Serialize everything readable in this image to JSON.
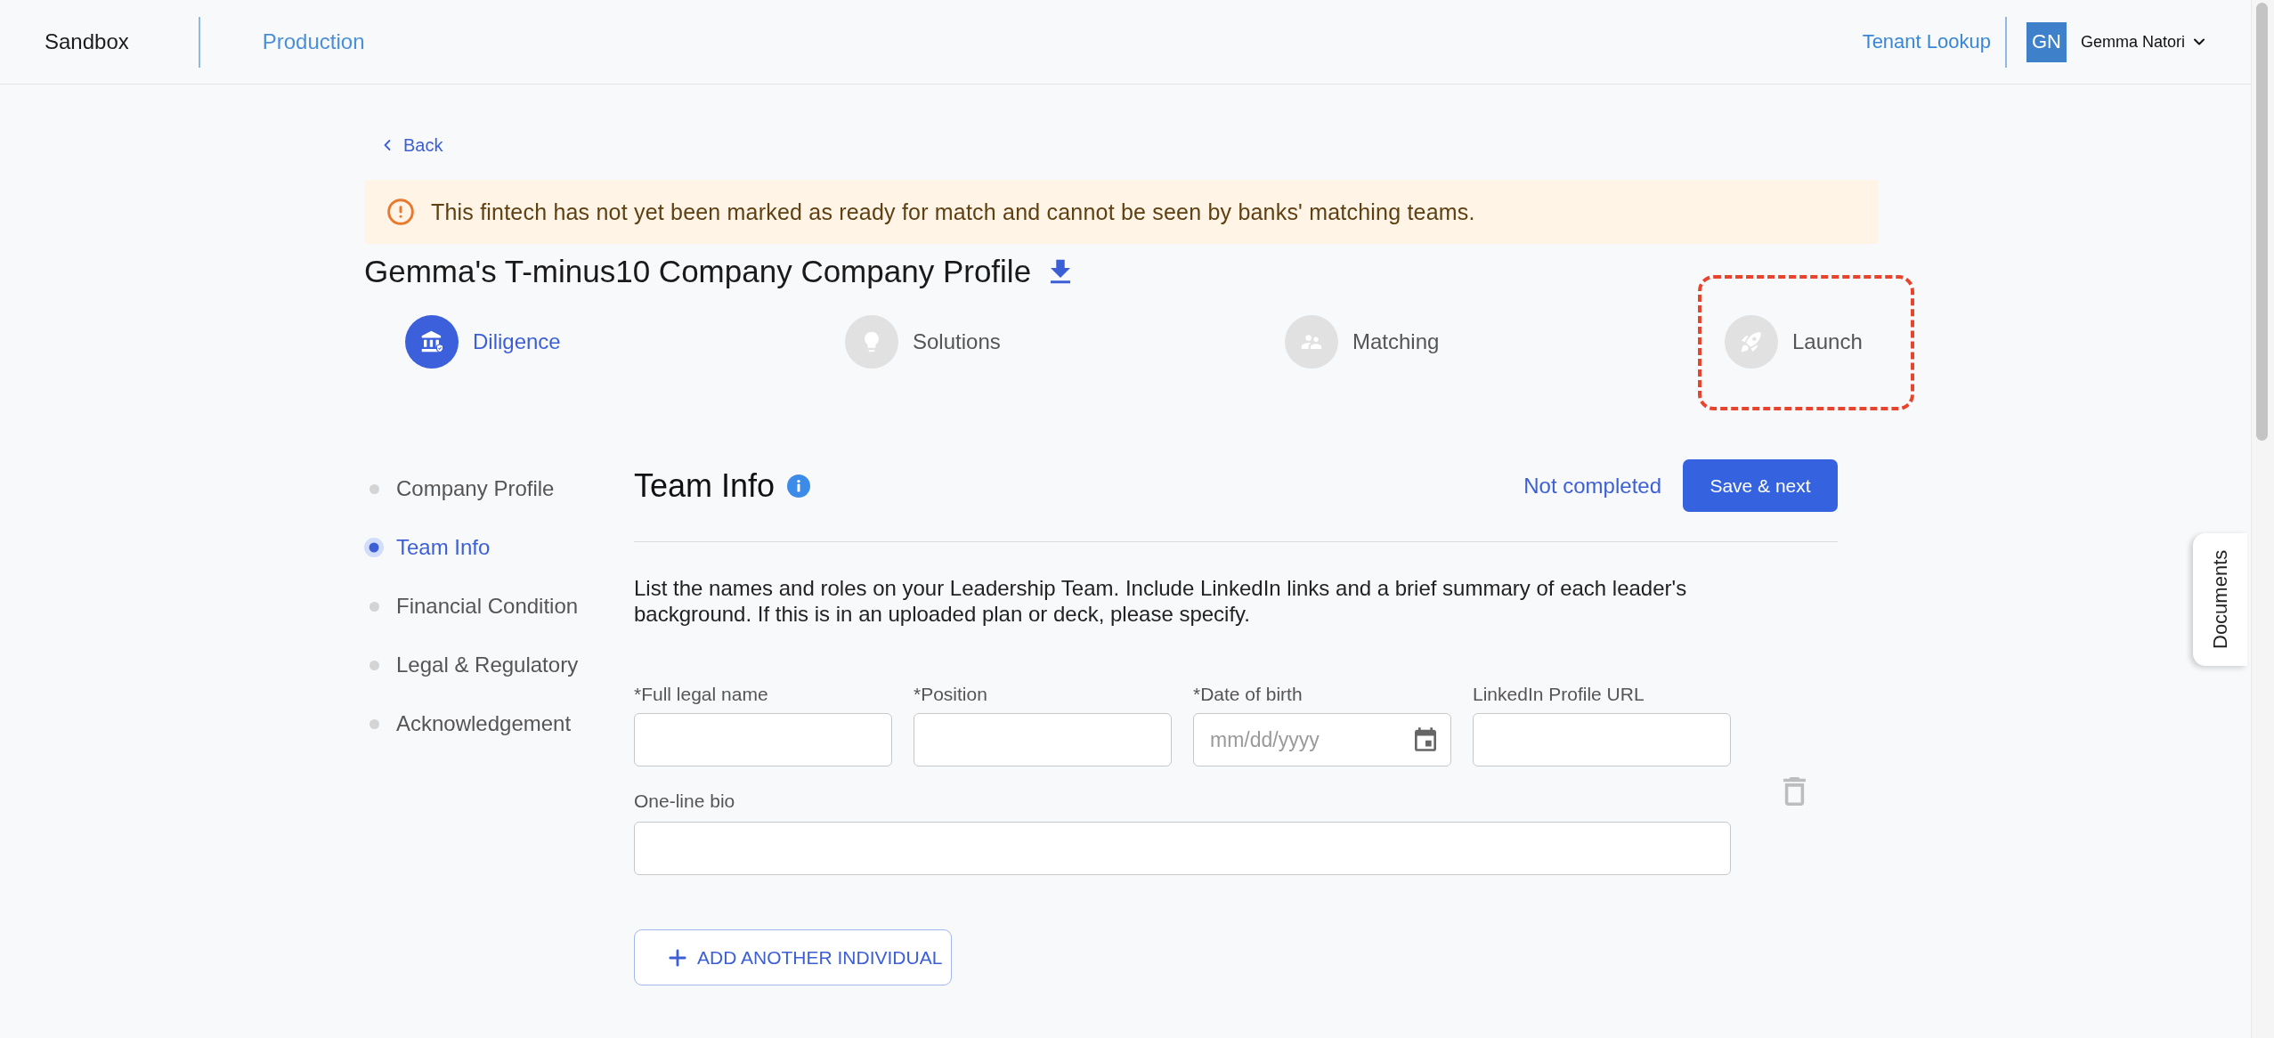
{
  "top_bar": {
    "environments": [
      {
        "label": "Sandbox",
        "selected": true
      },
      {
        "label": "Production",
        "selected": false
      }
    ],
    "tenant_lookup": "Tenant Lookup",
    "user": {
      "initials": "GN",
      "name": "Gemma Natori"
    }
  },
  "back": "Back",
  "alert": {
    "kind": "warning",
    "text": "This fintech has not yet been marked as ready for match and cannot be seen by banks' matching teams."
  },
  "title": "Gemma's T-minus10 Company Company Profile",
  "steps": [
    {
      "label": "Diligence",
      "kind": "diligence",
      "selected": true,
      "highlighted": false
    },
    {
      "label": "Solutions",
      "kind": "solutions",
      "selected": false,
      "highlighted": false
    },
    {
      "label": "Matching",
      "kind": "matching",
      "selected": false,
      "highlighted": false
    },
    {
      "label": "Launch",
      "kind": "launch",
      "selected": false,
      "highlighted": true
    }
  ],
  "section_nav": [
    {
      "label": "Company Profile",
      "selected": false
    },
    {
      "label": "Team Info",
      "selected": true
    },
    {
      "label": "Financial Condition",
      "selected": false
    },
    {
      "label": "Legal & Regulatory",
      "selected": false
    },
    {
      "label": "Acknowledgement",
      "selected": false
    }
  ],
  "section": {
    "title": "Team Info",
    "status": "Not completed",
    "save_button": "Save & next",
    "description": "List the names and roles on your Leadership Team. Include LinkedIn links and a brief summary of each leader's background. If this is in an uploaded plan or deck, please specify.",
    "fields": [
      {
        "label": "*Full legal name",
        "kind": "text"
      },
      {
        "label": "*Position",
        "kind": "text"
      },
      {
        "label": "*Date of birth",
        "kind": "date",
        "placeholder": "mm/dd/yyyy"
      },
      {
        "label": "LinkedIn Profile URL",
        "kind": "text"
      }
    ],
    "bio": {
      "label": "One-line bio"
    },
    "add_button": "ADD ANOTHER INDIVIDUAL"
  },
  "documents_tab": "Documents"
}
